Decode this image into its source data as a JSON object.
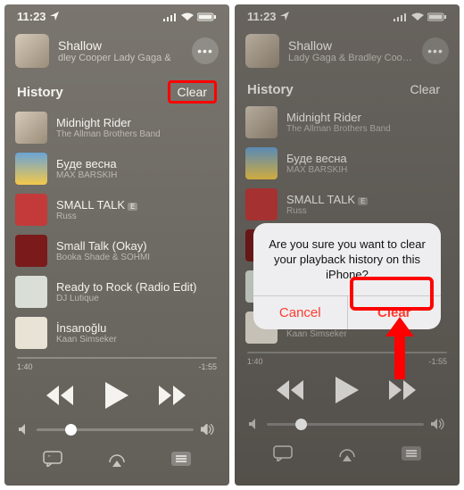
{
  "status": {
    "time": "11:23",
    "loc_icon": "location-icon"
  },
  "nowplaying": {
    "title": "Shallow",
    "artist_left_truncated": "dley Cooper     Lady Gaga &",
    "artist_full": "Lady Gaga & Bradley Cooper"
  },
  "section": {
    "title": "History",
    "clear": "Clear"
  },
  "history": [
    {
      "title": "Midnight Rider",
      "artist": "The Allman Brothers Band",
      "art": "art-a",
      "explicit": false
    },
    {
      "title": "Буде весна",
      "artist": "MAX BARSKIH",
      "art": "art-b",
      "explicit": false
    },
    {
      "title": "SMALL TALK",
      "artist": "Russ",
      "art": "art-c",
      "explicit": true
    },
    {
      "title": "Small Talk (Okay)",
      "artist": "Booka Shade & SOHMI",
      "art": "art-d",
      "explicit": false
    },
    {
      "title": "Ready to Rock (Radio Edit)",
      "artist": "DJ Lutique",
      "art": "art-e",
      "explicit": false
    },
    {
      "title": "İnsanoğlu",
      "artist": "Kaan Simseker",
      "art": "art-f",
      "explicit": false
    }
  ],
  "scrubber": {
    "elapsed": "1:40",
    "remaining": "-1:55"
  },
  "alert": {
    "message": "Are you sure you want to clear your playback history on this iPhone?",
    "cancel": "Cancel",
    "confirm": "Clear"
  }
}
